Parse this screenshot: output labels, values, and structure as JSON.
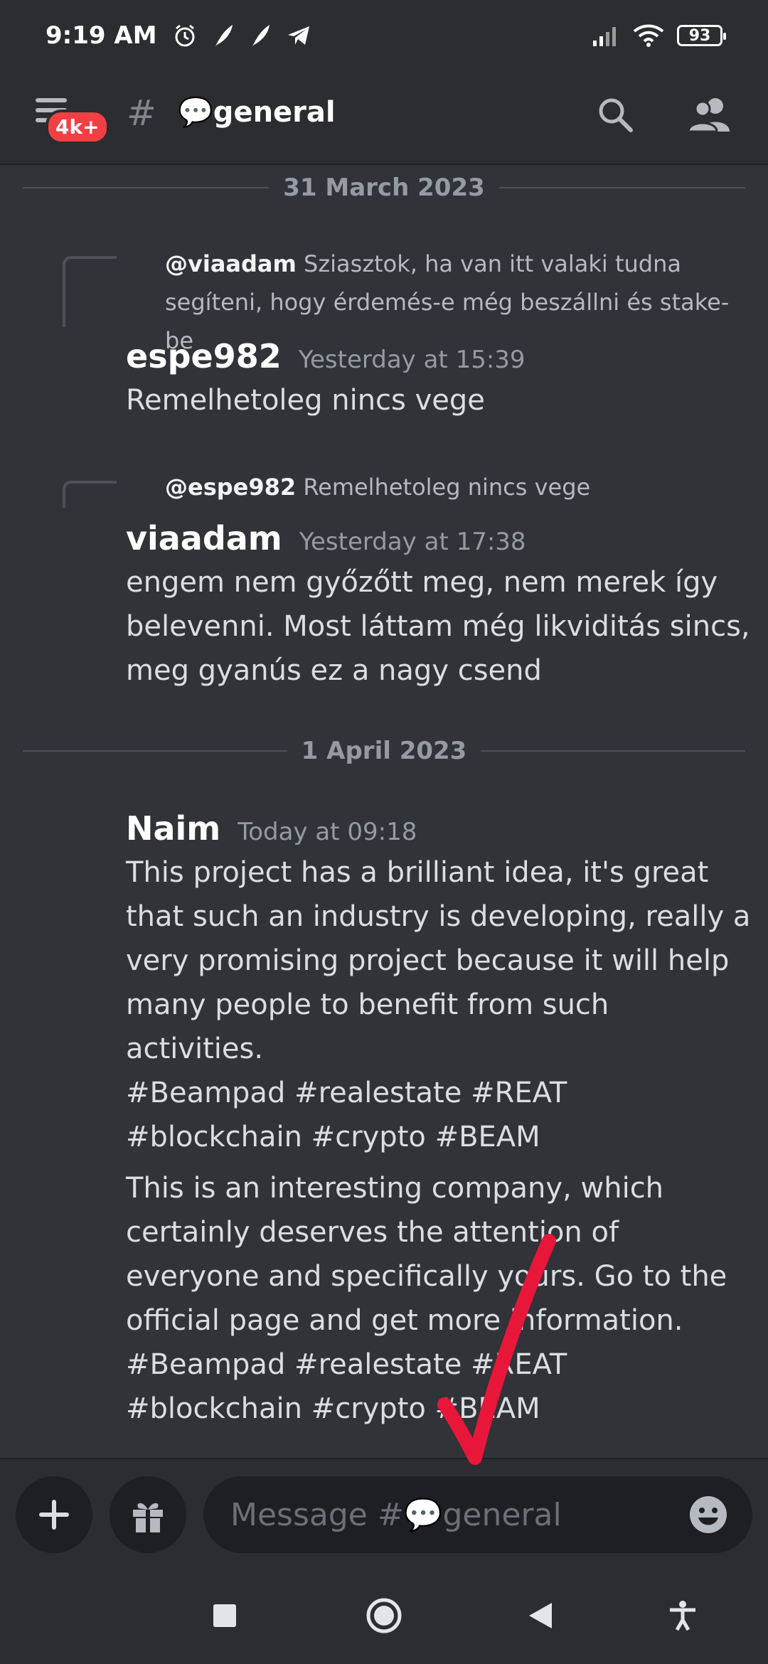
{
  "status_bar": {
    "time": "9:19 AM",
    "battery": "93"
  },
  "header": {
    "badge": "4k+",
    "channel_title": "💬general"
  },
  "dividers": [
    "31 March 2023",
    "1 April 2023"
  ],
  "messages": [
    {
      "reply_to": {
        "user": "@viaadam",
        "text": "Sziasztok, ha van itt valaki tudna segíteni, hogy érdemés-e még beszállni és stake-be"
      },
      "author": "espe982",
      "time": "Yesterday at 15:39",
      "paragraphs": [
        "Remelhetoleg nincs vege"
      ]
    },
    {
      "reply_to": {
        "user": "@espe982",
        "text": "Remelhetoleg nincs vege"
      },
      "author": "viaadam",
      "time": "Yesterday at 17:38",
      "paragraphs": [
        "engem nem győzőtt meg, nem merek így belevenni. Most láttam még likviditás sincs, meg gyanús ez a nagy csend"
      ]
    },
    {
      "author": "Naim",
      "time": "Today at 09:18",
      "paragraphs": [
        "This project has a brilliant idea, it's great that such an industry is developing, really a very promising project because it will help many people to benefit from such activities.\n#Beampad #realestate #REAT #blockchain #crypto #BEAM",
        "This is an interesting company, which certainly deserves the attention of everyone and specifically yours. Go to the official page and get more information.\n#Beampad #realestate #REAT #blockchain #crypto #BEAM"
      ]
    }
  ],
  "composer": {
    "placeholder": "Message #💬general"
  },
  "colors": {
    "background": "#313338",
    "bar": "#2b2d31",
    "badge": "#f23f43",
    "annotation": "#e8173a"
  }
}
